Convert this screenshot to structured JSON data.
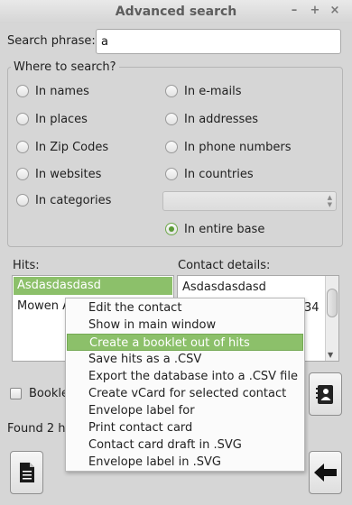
{
  "window": {
    "title": "Advanced search",
    "controls": [
      "–",
      "+",
      "×"
    ]
  },
  "search": {
    "label": "Search phrase:",
    "value": "a"
  },
  "scope": {
    "title": "Where to search?",
    "options": [
      {
        "label": "In names",
        "checked": false
      },
      {
        "label": "In e-mails",
        "checked": false
      },
      {
        "label": "In places",
        "checked": false
      },
      {
        "label": "In addresses",
        "checked": false
      },
      {
        "label": "In Zip Codes",
        "checked": false
      },
      {
        "label": "In phone numbers",
        "checked": false
      },
      {
        "label": "In websites",
        "checked": false
      },
      {
        "label": "In countries",
        "checked": false
      },
      {
        "label": "In categories",
        "checked": false
      },
      {
        "label": "In entire base",
        "checked": true
      }
    ],
    "countries_value": ""
  },
  "hits": {
    "label": "Hits:",
    "items": [
      "Asdasdasdasd",
      "Mowen A"
    ],
    "selected_index": 0
  },
  "details": {
    "label": "Contact details:",
    "name": "Asdasdasdasd",
    "partial": "34"
  },
  "booklet": {
    "label": "Booklet",
    "checked": false
  },
  "status": {
    "found": "Found 2 hi"
  },
  "buttons": {
    "contact_card": {
      "icon": "contact-book-icon"
    },
    "document": {
      "icon": "document-icon"
    },
    "back": {
      "icon": "arrow-left-icon"
    }
  },
  "context_menu": {
    "items": [
      "Edit the contact",
      "Show in main window",
      "Create a booklet out of hits",
      "Save hits as a .CSV",
      "Export the database into a .CSV file",
      "Create vCard for selected contact",
      "Envelope label for",
      "Print contact card",
      "Contact card draft in .SVG",
      "Envelope label in .SVG"
    ],
    "highlighted_index": 2
  },
  "colors": {
    "accent": "#8cc06a",
    "background": "#d6d6d6"
  }
}
